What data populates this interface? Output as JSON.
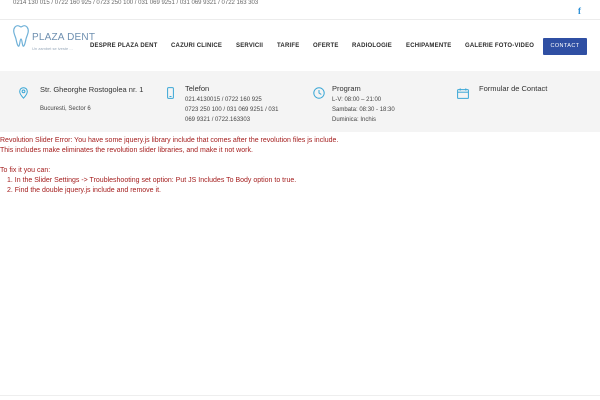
{
  "topbar": {
    "phones": "0214 130 015 / 0722 160 925 / 0723 250 100 / 031 069 9251 / 031 069 9321 / 0722 163 303",
    "facebook_glyph": "f"
  },
  "logo": {
    "name": "PLAZA DENT",
    "tagline": "Un zambet se iveste ...",
    "icon": "tooth-icon"
  },
  "nav": {
    "items": [
      "DESPRE PLAZA DENT",
      "CAZURI CLINICE",
      "SERVICII",
      "TARIFE",
      "OFERTE",
      "RADIOLOGIE",
      "ECHIPAMENTE",
      "GALERIE FOTO-VIDEO"
    ],
    "contact_label": "CONTACT"
  },
  "info": {
    "address": {
      "icon": "map-pin-icon",
      "title": "Str. Gheorghe Rostogolea nr. 1",
      "text": "Bucuresti, Sector 6"
    },
    "phone": {
      "icon": "phone-icon",
      "title": "Telefon",
      "lines": [
        "021.4130015 / 0722 160 925",
        "0723 250 100 / 031 069 9251 / 031",
        "069 9321 / 0722.163303"
      ]
    },
    "schedule": {
      "icon": "clock-icon",
      "title": "Program",
      "lines": [
        "L-V: 08:00 – 21:00",
        "Sambata: 08:30 - 18:30",
        "Duminica: Inchis"
      ]
    },
    "form": {
      "icon": "calendar-icon",
      "title": "Formular de Contact"
    }
  },
  "error": {
    "line1": "Revolution Slider Error: You have some jquery.js library include that comes after the revolution files js include.",
    "line2": "This includes make eliminates the revolution slider libraries, and make it not work.",
    "fix_intro": "To fix it you can:",
    "steps": [
      "1. In the Slider Settings -> Troubleshooting set option: Put JS Includes To Body option to true.",
      "2. Find the double jquery.js include and remove it."
    ]
  },
  "colors": {
    "accent": "#2f4fa3",
    "icon_blue": "#3aa7d6",
    "error_red": "#a41e1e",
    "strip_bg": "#f4f4f4"
  }
}
